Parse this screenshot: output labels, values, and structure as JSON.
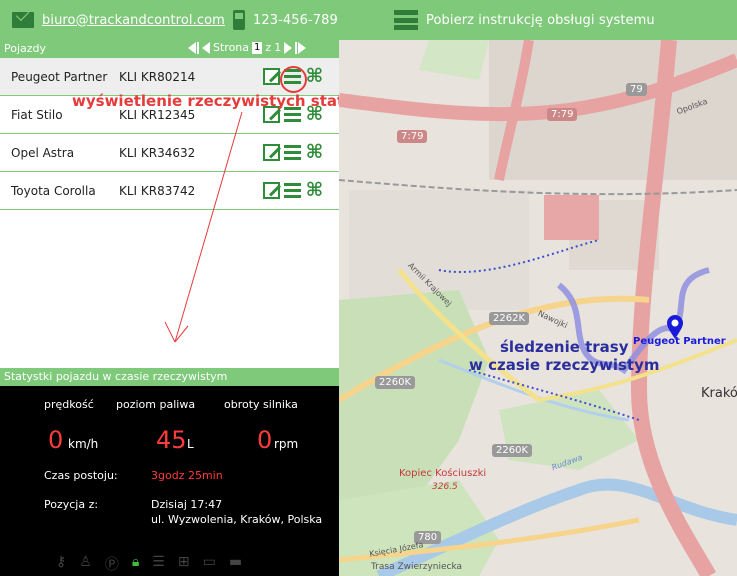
{
  "topbar": {
    "email": "biuro@trackandcontrol.com",
    "phone": "123-456-789",
    "manual": "Pobierz instrukcję obsługi systemu"
  },
  "vehicles_panel": {
    "title": "Pojazdy",
    "pager_label": "Strona",
    "current_page": "1",
    "of_label": "z",
    "total_pages": "1",
    "rows": [
      {
        "name": "Peugeot Partner",
        "plate": "KLI KR80214"
      },
      {
        "name": "Fiat Stilo",
        "plate": "KLI KR12345"
      },
      {
        "name": "Opel Astra",
        "plate": "KLI KR34632"
      },
      {
        "name": "Toyota Corolla",
        "plate": "KLI KR83742"
      }
    ]
  },
  "annotations": {
    "stats_hint": "wyświetlenie rzeczywistych statystyk pojazdu",
    "track_hint_line1": "śledzenie trasy",
    "track_hint_line2": "w czasie rzeczywistym"
  },
  "stats": {
    "title": "Statystki pojazdu w czasie rzeczywistym",
    "speed_label": "prędkość",
    "fuel_label": "poziom paliwa",
    "rpm_label": "obroty silnika",
    "speed_value": "0",
    "speed_unit": "km/h",
    "fuel_value": "45",
    "fuel_unit": "L",
    "rpm_value": "0",
    "rpm_unit": "rpm",
    "idle_label": "Czas postoju:",
    "idle_value": "3godz 25min",
    "position_label": "Pozycja z:",
    "position_time": "Dzisiaj 17:47",
    "position_address": "ul. Wyzwolenia, Kraków, Polska"
  },
  "map": {
    "vehicle_label": "Peugeot Partner",
    "labels": [
      "7:79",
      "7:79",
      "2262K",
      "2260K",
      "2260K",
      "780",
      "79",
      "Nawojki",
      "Armii Krajowej",
      "Kopiec Kościuszki",
      "326.5",
      "Opolska",
      "Krakó",
      "Rudawa",
      "Księcia Józefa",
      "Trasa Zwierzyniecka"
    ]
  },
  "colors": {
    "accent": "#7fc97a",
    "icon_green": "#2f8d3a",
    "annotation_red": "#e53b3b",
    "annotation_blue": "#2b2f9e"
  }
}
